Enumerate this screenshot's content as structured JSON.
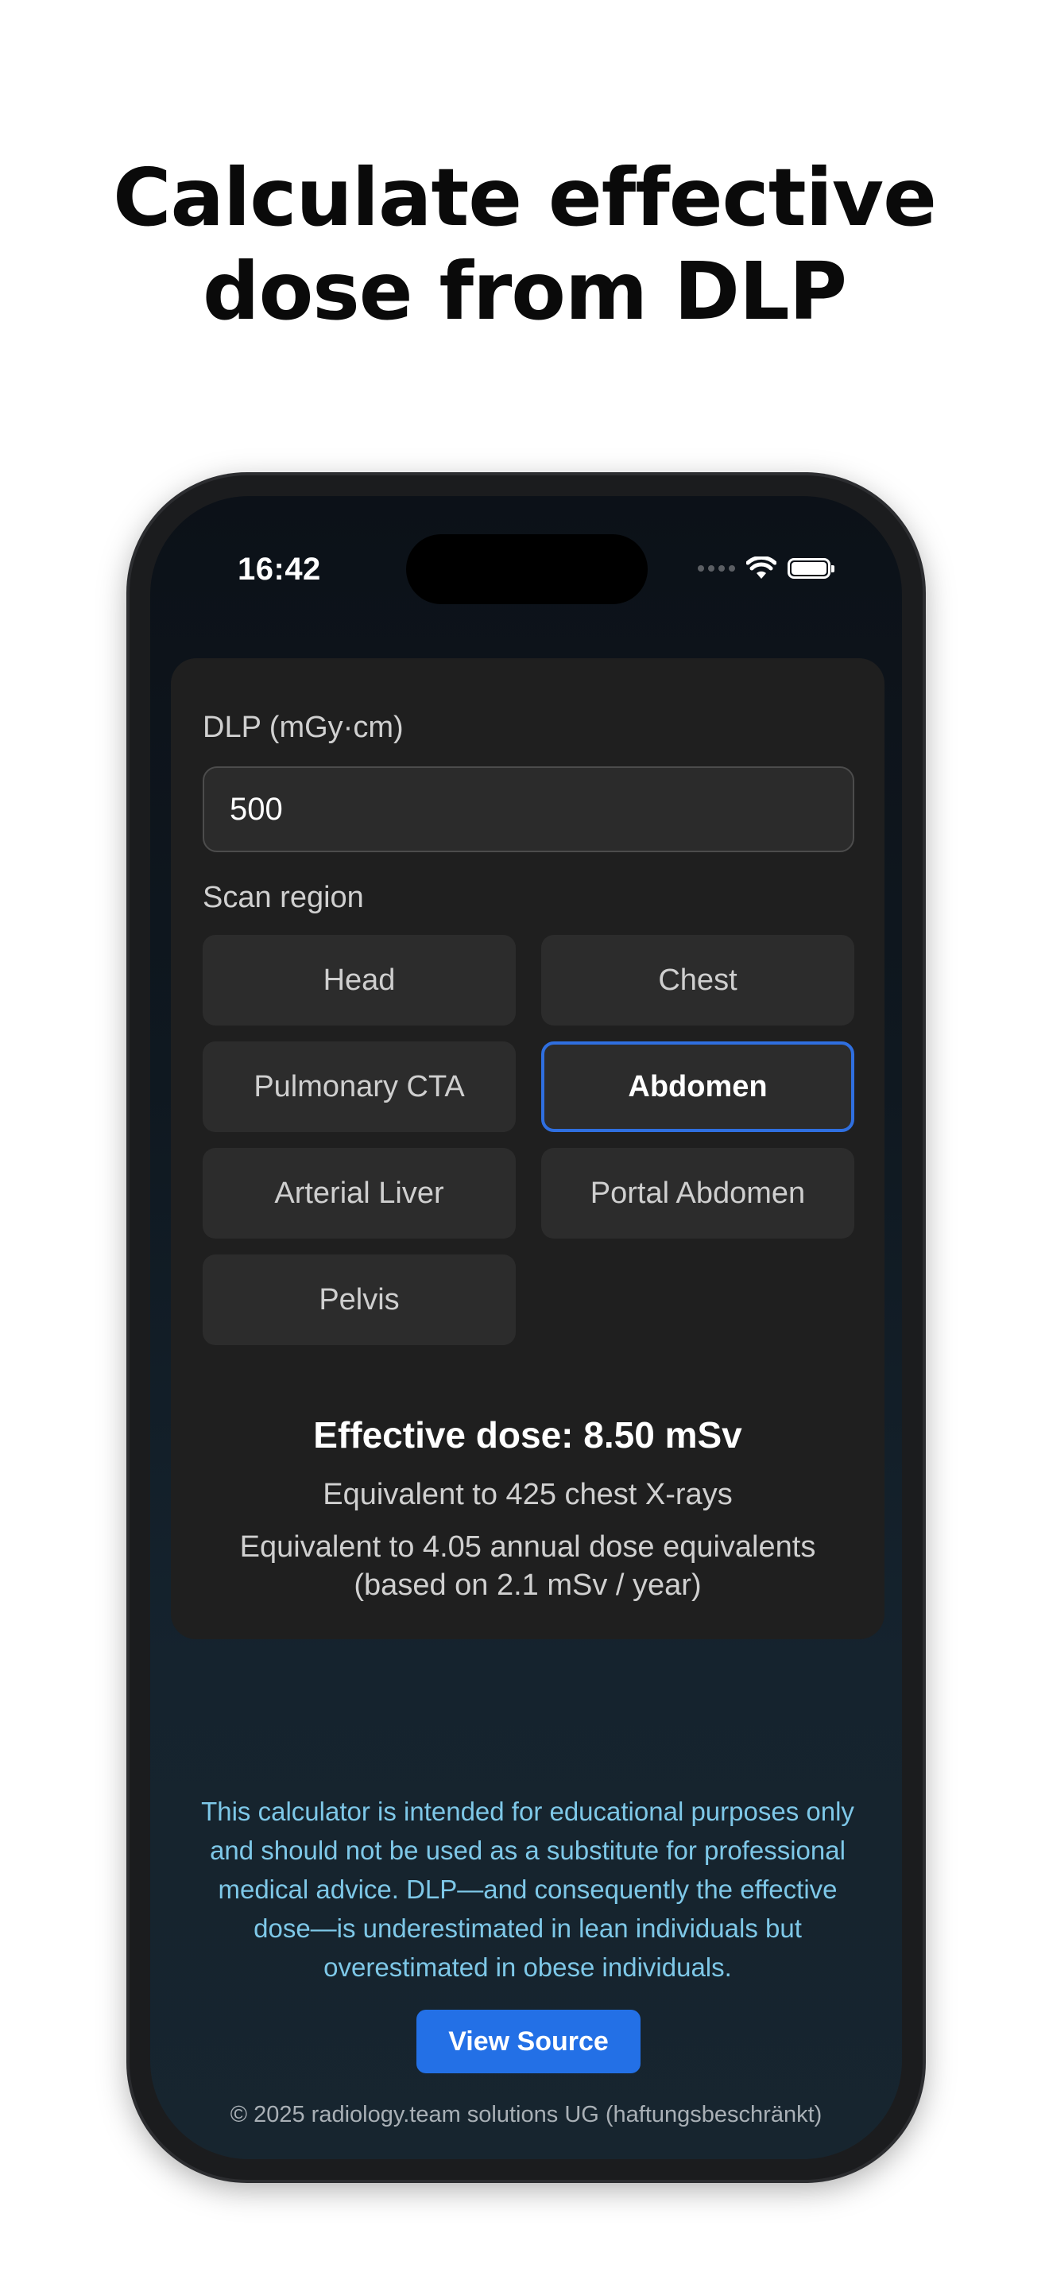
{
  "headline": {
    "line1": "Calculate effective",
    "line2": "dose from DLP"
  },
  "status_bar": {
    "time": "16:42",
    "icons": [
      "cellular-signal-icon",
      "wifi-icon",
      "battery-icon"
    ]
  },
  "form": {
    "dlp_label": "DLP (mGy·cm)",
    "dlp_value": "500",
    "scan_region_label": "Scan region",
    "regions": [
      {
        "label": "Head",
        "selected": false
      },
      {
        "label": "Chest",
        "selected": false
      },
      {
        "label": "Pulmonary CTA",
        "selected": false
      },
      {
        "label": "Abdomen",
        "selected": true
      },
      {
        "label": "Arterial Liver",
        "selected": false
      },
      {
        "label": "Portal Abdomen",
        "selected": false
      },
      {
        "label": "Pelvis",
        "selected": false
      }
    ]
  },
  "result": {
    "effective_dose": "Effective dose: 8.50 mSv",
    "chest_xrays": "Equivalent to 425 chest X-rays",
    "annual_equivalent": "Equivalent to 4.05 annual dose equivalents",
    "annual_basis": "(based on 2.1 mSv / year)"
  },
  "footer": {
    "disclaimer": "This calculator is intended for educational purposes only and should not be used as a substitute for professional medical advice. DLP—and consequently the effective dose—is underestimated in lean individuals but overestimated in obese individuals.",
    "view_source_label": "View Source",
    "copyright": "© 2025 radiology.team solutions UG (haftungsbeschränkt)"
  },
  "colors": {
    "accent": "#2370e6",
    "selected_border": "#2f6fe0",
    "disclaimer_text": "#7ec8e8",
    "card_background": "#1f1f1f"
  }
}
